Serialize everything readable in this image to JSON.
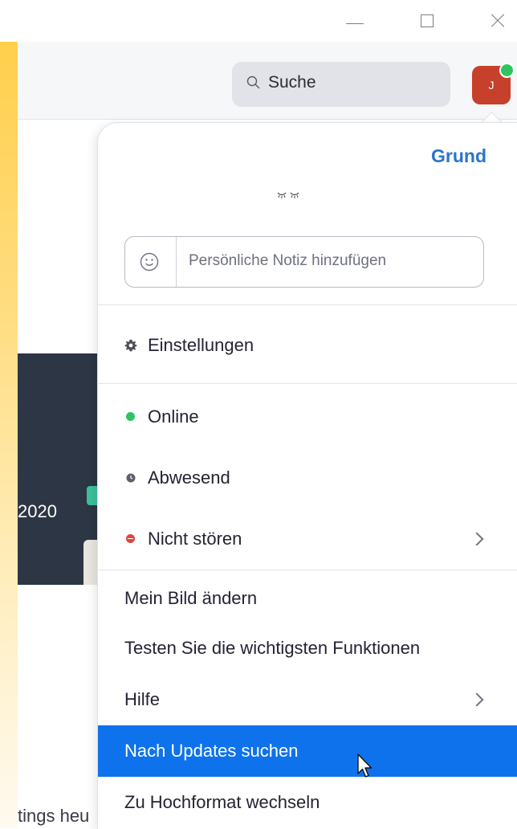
{
  "window_controls": {
    "minimize": "minimize-icon",
    "maximize": "maximize-icon",
    "close": "close-icon"
  },
  "header": {
    "search_label": "Suche",
    "avatar_initial": "J",
    "presence_status": "online"
  },
  "background": {
    "year_text": "2020",
    "footer_text": "tings heu"
  },
  "profile_menu": {
    "plan_label": "Grund",
    "note_placeholder": "Persönliche Notiz hinzufügen",
    "settings": "Einstellungen",
    "status_online": "Online",
    "status_away": "Abwesend",
    "status_dnd": "Nicht stören",
    "change_picture": "Mein Bild ändern",
    "try_features": "Testen Sie die wichtigsten Funktionen",
    "help": "Hilfe",
    "check_updates": "Nach Updates suchen",
    "switch_portrait": "Zu Hochformat wechseln"
  },
  "colors": {
    "accent_blue": "#0e72ed",
    "plan_blue": "#2b74c8",
    "online_green": "#2fc45e",
    "dnd_red": "#e0443c",
    "avatar_red": "#c7402c"
  }
}
